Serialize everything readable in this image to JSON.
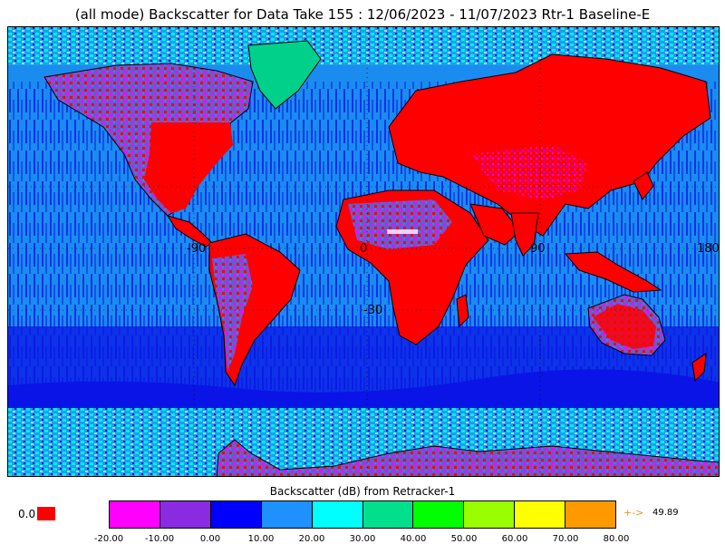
{
  "title": "(all mode) Backscatter for Data Take 155 : 12/06/2023 - 11/07/2023 Rtr-1 Baseline-E",
  "map": {
    "longitude_labels": [
      "-90",
      "0",
      "90",
      "180"
    ],
    "latitude_labels": [
      "-30"
    ],
    "colors": {
      "ocean": "#1a8cf0",
      "ocean_dark": "#0a14e6",
      "land": "#ff0000",
      "land_magenta": "#ff00ff",
      "ice_cyan": "#00eeee",
      "ice_green": "#00e38a",
      "coast": "#000000"
    }
  },
  "colorbar": {
    "title": "Backscatter (dB) from Retracker-1",
    "tick_labels": [
      "-20.00",
      "-10.00",
      "0.00",
      "10.00",
      "20.00",
      "30.00",
      "40.00",
      "50.00",
      "60.00",
      "70.00",
      "80.00"
    ],
    "colors": [
      "#ff00ff",
      "#8a2be2",
      "#0000ff",
      "#1e90ff",
      "#00ffff",
      "#00e08c",
      "#00ff00",
      "#99ff00",
      "#ffff00",
      "#ff9900"
    ]
  },
  "legend": {
    "zero_label": "0.0",
    "zero_color": "#ff0000",
    "arrow": "+->",
    "max_value": "49.89"
  }
}
